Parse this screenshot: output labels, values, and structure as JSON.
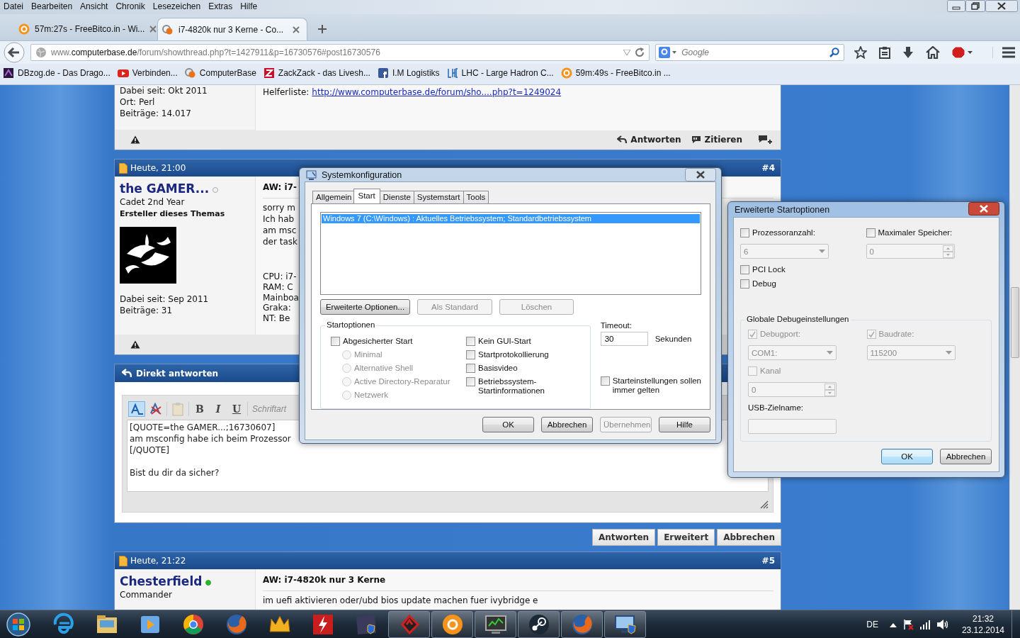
{
  "menu_bar": [
    "Datei",
    "Bearbeiten",
    "Ansicht",
    "Chronik",
    "Lesezeichen",
    "Extras",
    "Hilfe"
  ],
  "tabs": [
    {
      "label": "57m:27s - FreeBitco.in - Wi...",
      "kind": "bitcoin",
      "selected": false
    },
    {
      "label": "i7-4820k nur 3 Kerne - Co...",
      "kind": "cb",
      "selected": true
    }
  ],
  "address_bar": {
    "url": "www.**computerbase.de**/forum/showthread.php?t=1427911&p=16730576#post16730576"
  },
  "search_box": {
    "placeholder": "Google"
  },
  "bookmarks": [
    {
      "kind": "dbzog",
      "label": "DBzog.de - Das Drago..."
    },
    {
      "kind": "youtube",
      "label": "Verbinden..."
    },
    {
      "kind": "cb",
      "label": "ComputerBase"
    },
    {
      "kind": "zackzack",
      "label": "ZackZack - das Livesh..."
    },
    {
      "kind": "facebook",
      "label": "I.M Logistiks"
    },
    {
      "kind": "lhc",
      "label": "LHC - Large Hadron C..."
    },
    {
      "kind": "bitcoin",
      "label": "59m:49s - FreeBitco.in ..."
    }
  ],
  "thread": [
    {
      "kind": "post",
      "author": {
        "details": [
          "Dabei seit: Okt 2011",
          "Ort: Perl",
          "Beiträge: 14.017"
        ]
      },
      "links": [
        {
          "label": "Helferliste:",
          "url": "http://www.computerbase.de/forum/sho....php?t=1249024"
        }
      ],
      "footer": {
        "report": true,
        "actions": [
          "Antworten",
          "Zitieren"
        ]
      }
    },
    {
      "kind": "post",
      "header": {
        "date": "Heute, 21:00",
        "number": "#4"
      },
      "author": {
        "name": "the GAMER...",
        "online": false,
        "rank": "Cadet 2nd Year",
        "badge": "Ersteller dieses Themas",
        "avatar": {
          "kind": "picture"
        },
        "details": [
          "Dabei seit: Sep 2011",
          "Beiträge: 31"
        ]
      },
      "title": "AW: i7-",
      "message": [
        "sorry m",
        "Ich hab",
        "am msc",
        "der task"
      ],
      "signature": [
        "CPU: i7-",
        "RAM: C",
        "Mainboa",
        "Graka:",
        "NT: Be"
      ],
      "footer": {
        "report": true
      }
    },
    {
      "kind": "quick_reply",
      "title": "Direkt antworten",
      "format_buttons": [
        "B",
        "I",
        "U"
      ],
      "font_placeholder": "Schriftart",
      "text": "[QUOTE=the GAMER...;16730607]\nam msconfig habe ich beim Prozessor\n[/QUOTE]\n\nBist du dir da sicher?",
      "buttons": [
        "Antworten",
        "Erweitert",
        "Abbrechen"
      ]
    },
    {
      "kind": "post",
      "header": {
        "date": "Heute, 21:22",
        "number": "#5"
      },
      "author": {
        "name": "Chesterfield",
        "online": true,
        "rank": "Commander"
      },
      "title": "AW: i7-4820k nur 3 Kerne",
      "message": [
        "im uefi aktivieren oder/ubd bios update machen fuer ivybridge e"
      ]
    }
  ],
  "system_config": {
    "title": "Systemkonfiguration",
    "tabs": [
      {
        "label": "Allgemein",
        "selected": false
      },
      {
        "label": "Start",
        "selected": true
      },
      {
        "label": "Dienste",
        "selected": false
      },
      {
        "label": "Systemstart",
        "selected": false
      },
      {
        "label": "Tools",
        "selected": false
      }
    ],
    "boot_entries": [
      {
        "label": "Windows 7 (C:\\Windows) : Aktuelles Betriebssystem; Standardbetriebssystem",
        "selected": true
      }
    ],
    "entry_buttons": [
      {
        "label": "Erweiterte Optionen...",
        "disabled": false
      },
      {
        "label": "Als Standard",
        "disabled": true
      },
      {
        "label": "Löschen",
        "disabled": true
      }
    ],
    "boot_options": {
      "title": "Startoptionen",
      "left": [
        {
          "kind": "checkbox",
          "label": "Abgesicherter Start",
          "checked": false,
          "disabled": false
        },
        {
          "kind": "radio",
          "label": "Minimal",
          "checked": false,
          "disabled": true
        },
        {
          "kind": "radio",
          "label": "Alternative Shell",
          "checked": false,
          "disabled": true
        },
        {
          "kind": "radio",
          "label": "Active Directory-Reparatur",
          "checked": false,
          "disabled": true
        },
        {
          "kind": "radio",
          "label": "Netzwerk",
          "checked": false,
          "disabled": true
        }
      ],
      "right": [
        {
          "kind": "checkbox",
          "label": "Kein GUI-Start",
          "checked": false,
          "disabled": false
        },
        {
          "kind": "checkbox",
          "label": "Startprotokollierung",
          "checked": false,
          "disabled": false
        },
        {
          "kind": "checkbox",
          "label": "Basisvideo",
          "checked": false,
          "disabled": false
        },
        {
          "kind": "checkbox",
          "label": "Betriebssystem-\nStartinformationen",
          "checked": false,
          "disabled": false
        }
      ]
    },
    "timeout": {
      "label": "Timeout:",
      "value": "30",
      "unit": "Sekunden"
    },
    "persist": {
      "kind": "checkbox",
      "label": "Starteinstellungen sollen\nimmer gelten",
      "checked": false,
      "disabled": false
    },
    "buttons": [
      {
        "label": "OK",
        "disabled": false
      },
      {
        "label": "Abbrechen",
        "disabled": false
      },
      {
        "label": "Übernehmen",
        "disabled": true
      },
      {
        "label": "Hilfe",
        "disabled": false
      }
    ]
  },
  "advanced_options": {
    "title": "Erweiterte Startoptionen",
    "rows": [
      [
        {
          "kind": "checkbox",
          "label": "Prozessoranzahl:",
          "checked": false,
          "disabled": false,
          "control": {
            "kind": "dropdown",
            "value": "6",
            "disabled": true
          }
        },
        {
          "kind": "checkbox",
          "label": "Maximaler Speicher:",
          "checked": false,
          "disabled": false,
          "control": {
            "kind": "spinner",
            "value": "0",
            "disabled": true
          }
        }
      ],
      [
        {
          "kind": "checkbox",
          "label": "PCI Lock",
          "checked": false,
          "disabled": false
        }
      ],
      [
        {
          "kind": "checkbox",
          "label": "Debug",
          "checked": false,
          "disabled": false
        }
      ]
    ],
    "debug_group": {
      "title": "Globale Debugeinstellungen",
      "rows": [
        [
          {
            "kind": "checkbox",
            "label": "Debugport:",
            "checked": true,
            "disabled": true,
            "control": {
              "kind": "dropdown",
              "value": "COM1:",
              "disabled": true
            }
          },
          {
            "kind": "checkbox",
            "label": "Baudrate:",
            "checked": true,
            "disabled": true,
            "control": {
              "kind": "dropdown",
              "value": "115200",
              "disabled": true
            }
          }
        ],
        [
          {
            "kind": "checkbox",
            "label": "Kanal",
            "checked": false,
            "disabled": true,
            "control": {
              "kind": "spinner",
              "value": "0",
              "disabled": true
            }
          }
        ],
        [
          {
            "kind": "text",
            "label": "USB-Zielname:",
            "control": {
              "kind": "textbox",
              "disabled": true
            }
          }
        ]
      ]
    },
    "buttons": [
      {
        "label": "OK",
        "default": true
      },
      {
        "label": "Abbrechen",
        "default": false
      }
    ]
  },
  "taskbar": {
    "apps": [
      {
        "kind": "ie",
        "running": false
      },
      {
        "kind": "explorer",
        "running": false
      },
      {
        "kind": "media",
        "running": false
      },
      {
        "kind": "chrome",
        "running": false
      },
      {
        "kind": "firefox",
        "running": false
      },
      {
        "kind": "crown",
        "running": false
      },
      {
        "kind": "flash",
        "running": false
      },
      {
        "kind": "shield",
        "running": false
      },
      {
        "kind": "tool",
        "running": true
      },
      {
        "kind": "bitcoin",
        "running": true
      },
      {
        "kind": "monitor",
        "running": true
      },
      {
        "kind": "steam",
        "running": true
      },
      {
        "kind": "firefox",
        "running": true
      },
      {
        "kind": "msconfig",
        "running": true
      }
    ],
    "language": "DE",
    "clock": {
      "time": "21:32",
      "date": "23.12.2014"
    }
  }
}
